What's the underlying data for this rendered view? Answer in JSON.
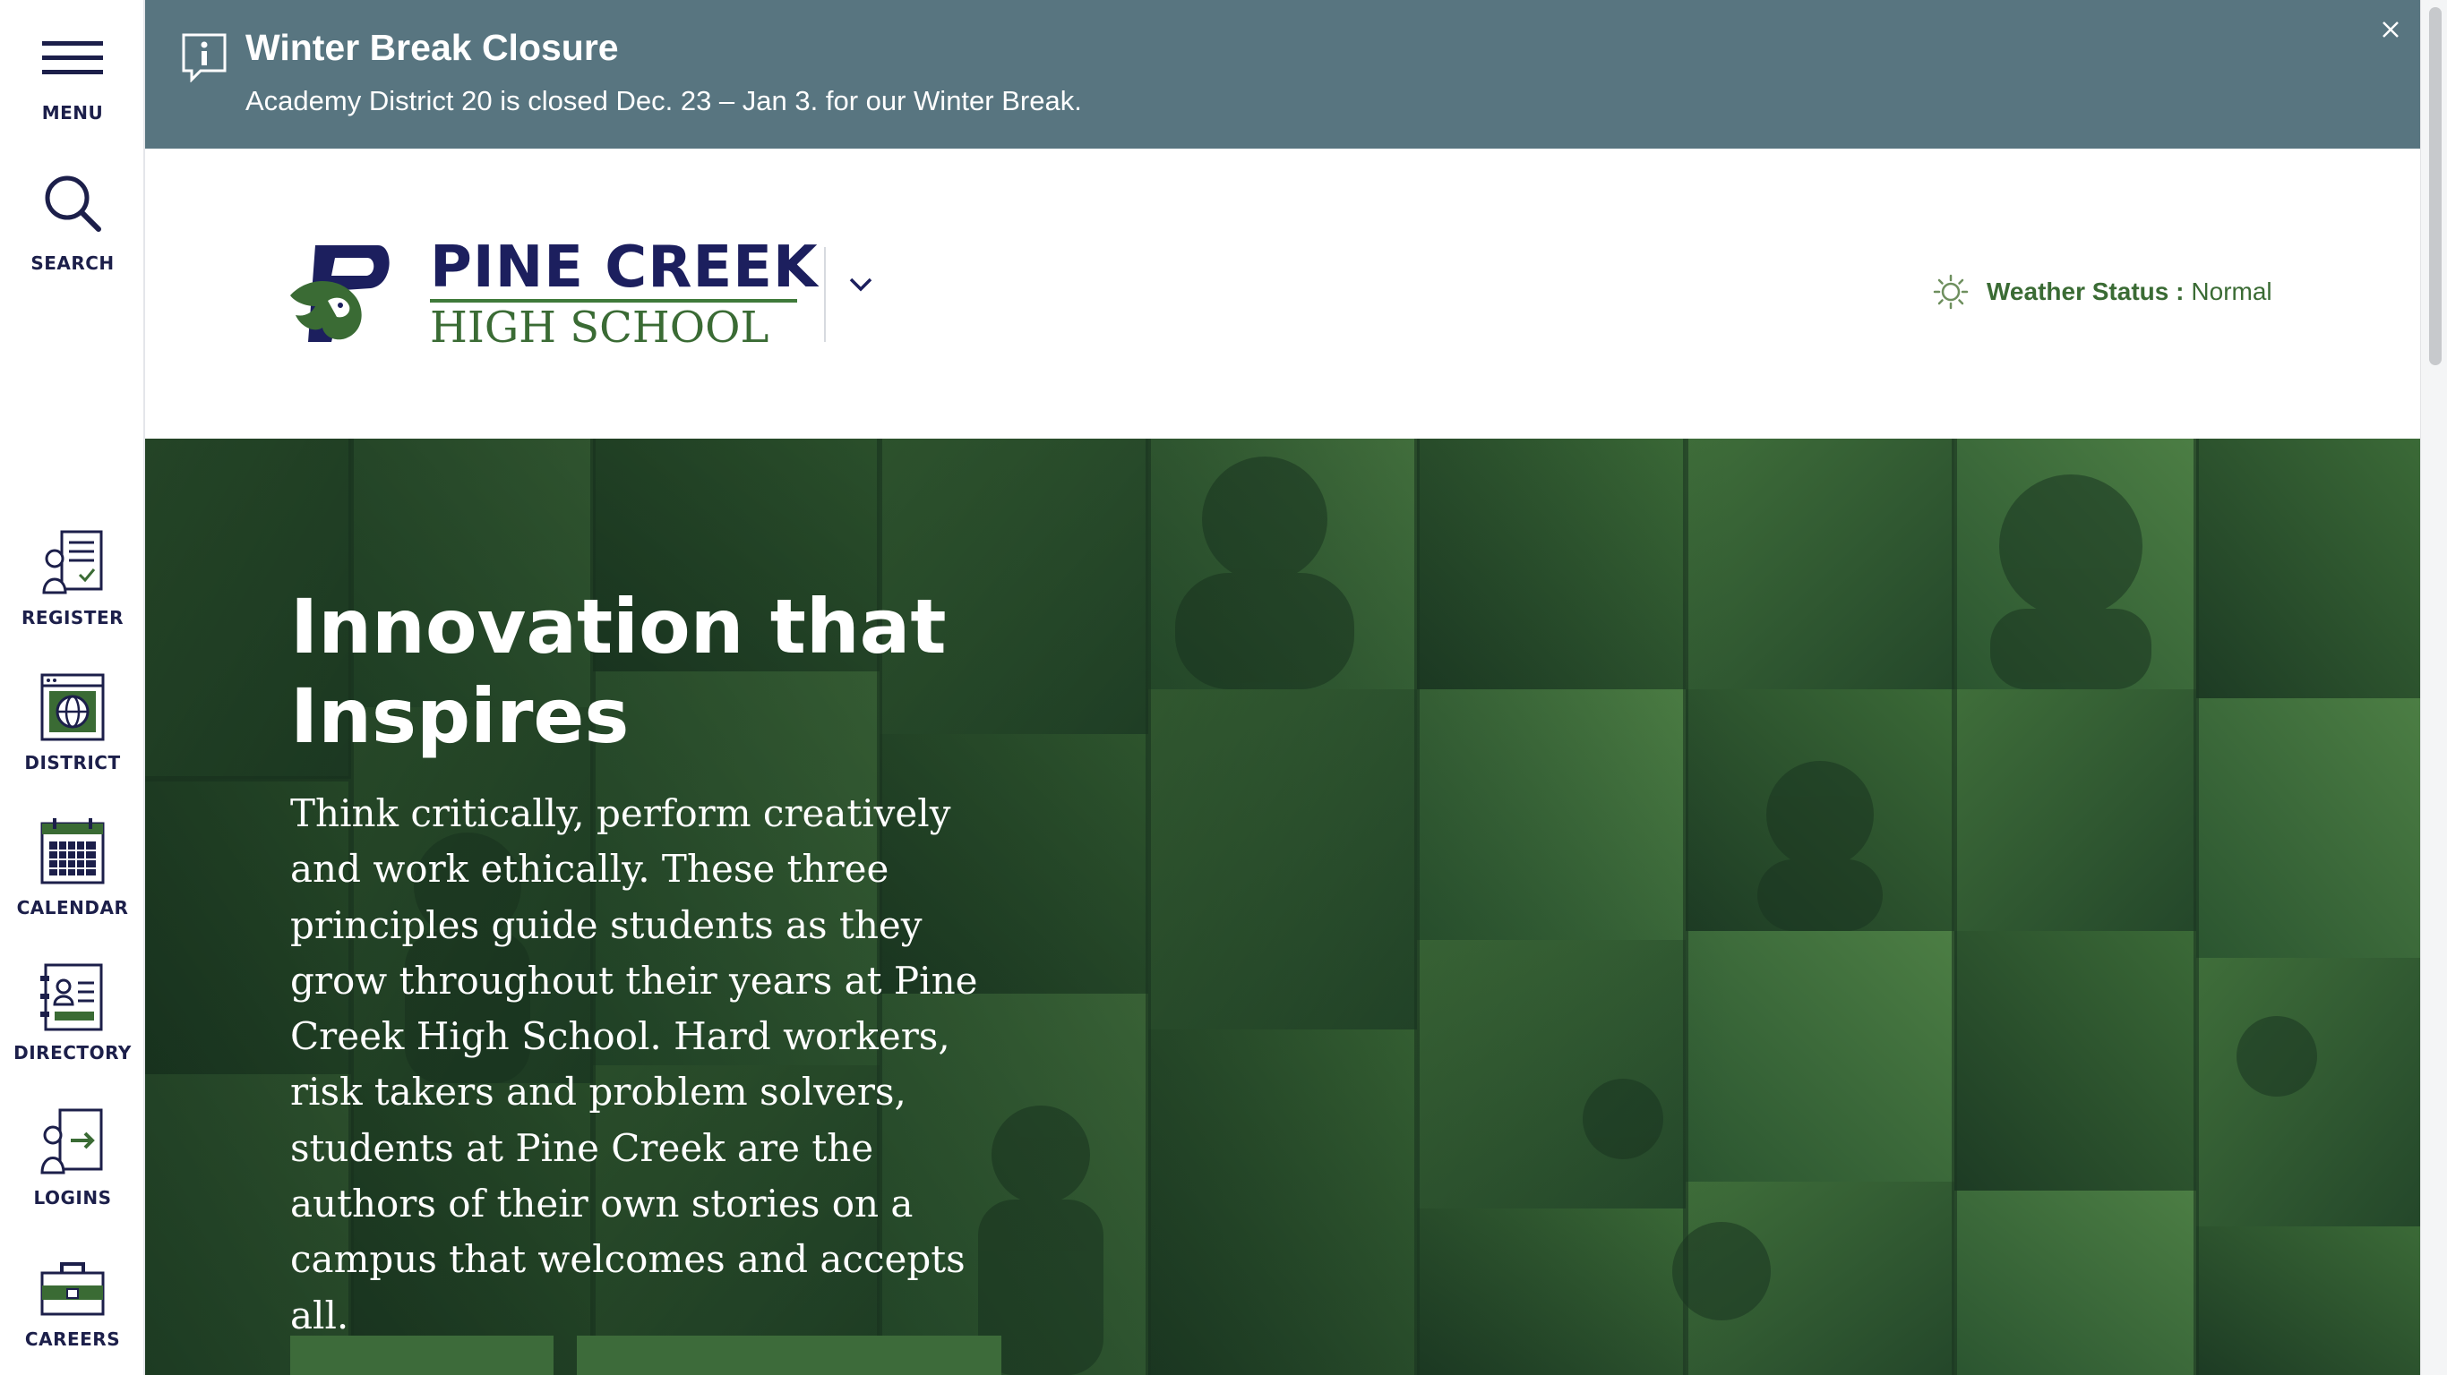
{
  "rail": {
    "menu": "MENU",
    "search": "SEARCH",
    "quick_links": [
      "REGISTER",
      "DISTRICT",
      "CALENDAR",
      "DIRECTORY",
      "LOGINS",
      "CAREERS"
    ]
  },
  "alert": {
    "title": "Winter Break Closure",
    "body": "Academy District 20 is closed Dec. 23 – Jan 3. for our Winter Break."
  },
  "header": {
    "school_name": "PINE CREEK",
    "school_type": "HIGH SCHOOL",
    "weather_label": "Weather Status :",
    "weather_value": "Normal"
  },
  "hero": {
    "title": "Innovation that Inspires",
    "text": "Think critically, perform creatively and work ethically. These three principles guide students as they grow throughout their years at Pine Creek High School. Hard workers, risk takers and problem solvers, students at Pine Creek are the authors of their own stories on a campus that welcomes and accepts all."
  },
  "colors": {
    "navy": "#1c1f5e",
    "green": "#3a6b34",
    "alert_bg": "#587580",
    "hero_tint": "#2e5a2c"
  },
  "icons": [
    "hamburger-icon",
    "search-icon",
    "register-icon",
    "district-icon",
    "calendar-icon",
    "directory-icon",
    "logins-icon",
    "careers-icon",
    "info-icon",
    "close-icon",
    "chevron-down-icon",
    "sun-icon"
  ]
}
